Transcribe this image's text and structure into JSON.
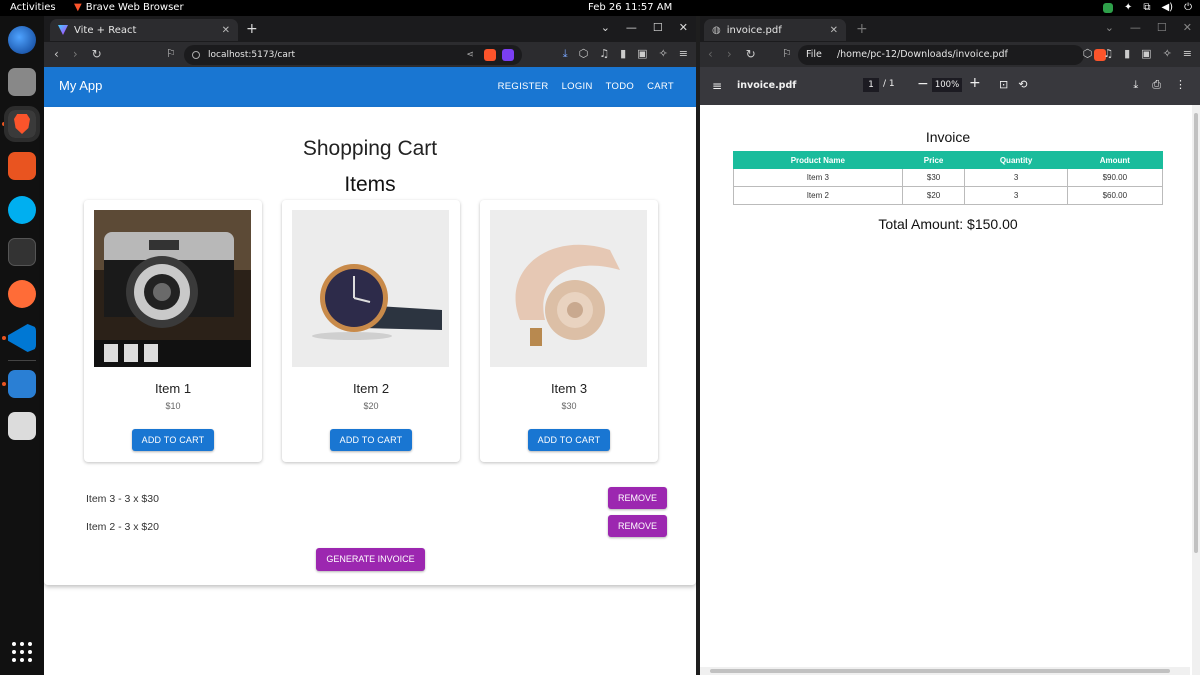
{
  "topbar": {
    "activities": "Activities",
    "browser_name": "Brave Web Browser",
    "clock": "Feb 26  11:57 AM"
  },
  "left_window": {
    "tab_title": "Vite + React",
    "url": "localhost:5173/cart"
  },
  "app": {
    "brand": "My App",
    "nav": [
      "REGISTER",
      "LOGIN",
      "TODO",
      "CART"
    ]
  },
  "cart_page": {
    "heading": "Shopping Cart",
    "items_heading": "Items",
    "products": [
      {
        "name": "Item 1",
        "price": "$10",
        "button": "ADD TO CART",
        "image": "camera"
      },
      {
        "name": "Item 2",
        "price": "$20",
        "button": "ADD TO CART",
        "image": "watch"
      },
      {
        "name": "Item 3",
        "price": "$30",
        "button": "ADD TO CART",
        "image": "headphones"
      }
    ],
    "cart_lines": [
      {
        "text": "Item 3 - 3 x $30",
        "button": "REMOVE"
      },
      {
        "text": "Item 2 - 3 x $20",
        "button": "REMOVE"
      }
    ],
    "generate_button": "GENERATE INVOICE",
    "colors": {
      "primary": "#1976d2",
      "secondary": "#9c27b0"
    }
  },
  "right_window": {
    "tab_title": "invoice.pdf",
    "url_prefix": "File",
    "url": "/home/pc-12/Downloads/invoice.pdf",
    "pdf_filename": "invoice.pdf",
    "page_current": "1",
    "page_total": "/ 1",
    "zoom": "100%"
  },
  "invoice": {
    "title": "Invoice",
    "headers": [
      "Product Name",
      "Price",
      "Quantity",
      "Amount"
    ],
    "rows": [
      [
        "Item 3",
        "$30",
        "3",
        "$90.00"
      ],
      [
        "Item 2",
        "$20",
        "3",
        "$60.00"
      ]
    ],
    "total": "Total Amount: $150.00",
    "header_color": "#1abc9c"
  }
}
